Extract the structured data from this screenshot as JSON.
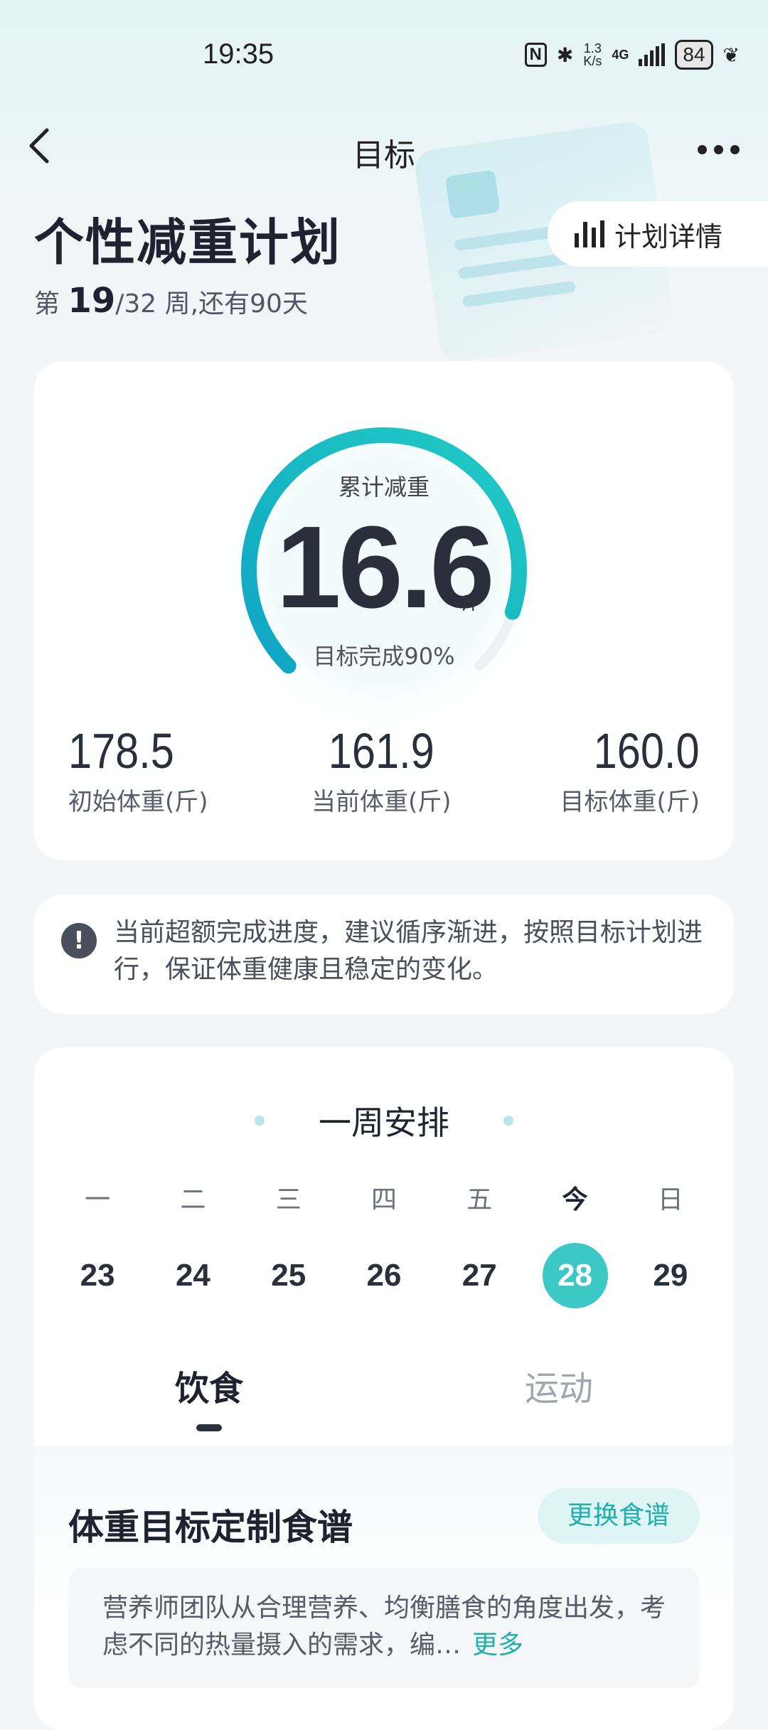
{
  "status_bar": {
    "time": "19:35",
    "nfc_icon": "N",
    "bluetooth_icon": "✱",
    "net_speed_value": "1.3",
    "net_speed_unit": "K/s",
    "network": "4G",
    "battery": "84"
  },
  "header": {
    "title": "目标"
  },
  "plan": {
    "title": "个性减重计划",
    "week_prefix": "第 ",
    "week_current": "19",
    "week_suffix": "/32 周,还有90天",
    "detail_label": "计划详情"
  },
  "progress": {
    "label": "累计减重",
    "value": "16.6",
    "unit": "斤",
    "completion_text": "目标完成90%",
    "completion_fraction": 0.9,
    "accent_color": "#1bbcc4",
    "stats": [
      {
        "value": "178.5",
        "label": "初始体重(斤)"
      },
      {
        "value": "161.9",
        "label": "当前体重(斤)"
      },
      {
        "value": "160.0",
        "label": "目标体重(斤)"
      }
    ]
  },
  "notice": {
    "icon": "!",
    "text": "当前超额完成进度，建议循序渐进，按照目标计划进行，保证体重健康且稳定的变化。"
  },
  "week": {
    "title": "一周安排",
    "days": [
      {
        "weekday": "一",
        "date": "23"
      },
      {
        "weekday": "二",
        "date": "24"
      },
      {
        "weekday": "三",
        "date": "25"
      },
      {
        "weekday": "四",
        "date": "26"
      },
      {
        "weekday": "五",
        "date": "27"
      },
      {
        "weekday": "今",
        "date": "28"
      },
      {
        "weekday": "日",
        "date": "29"
      }
    ],
    "today_color": "#3cc8c4",
    "tabs": {
      "diet": "饮食",
      "exercise": "运动"
    },
    "recipe": {
      "title": "体重目标定制食谱",
      "swap_label": "更换食谱",
      "description": "营养师团队从合理营养、均衡膳食的角度出发，考虑不同的热量摄入的需求，编…",
      "more_label": "更多"
    }
  }
}
